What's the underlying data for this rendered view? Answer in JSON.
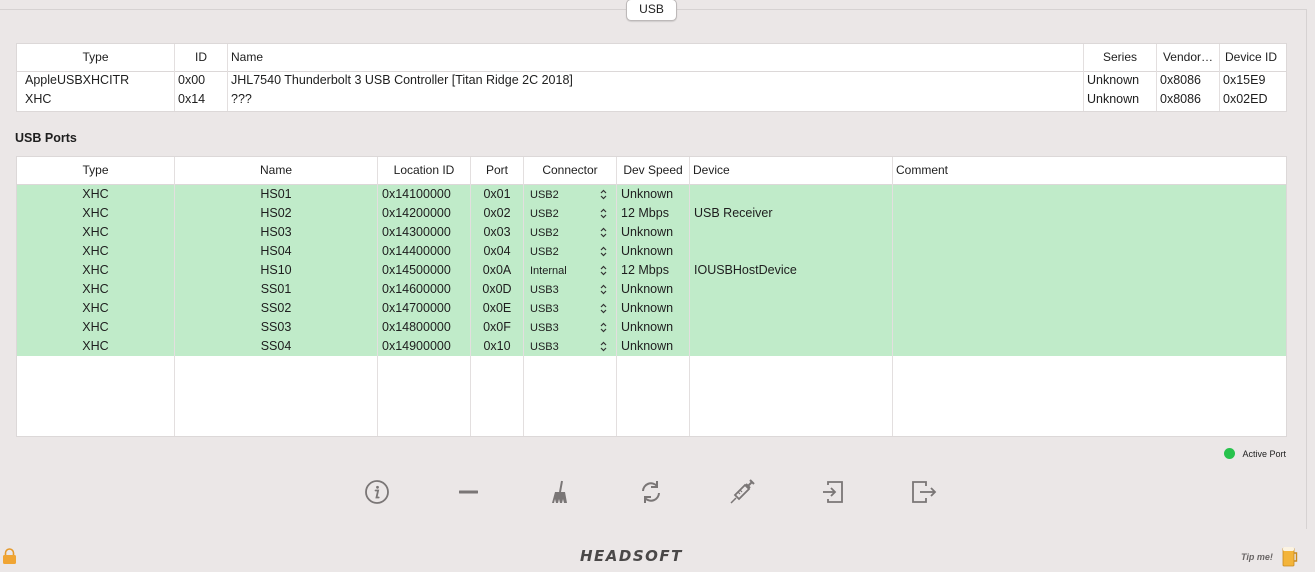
{
  "tabs": [
    {
      "label": "USB"
    }
  ],
  "controllers": {
    "columns": [
      "Type",
      "ID",
      "Name",
      "Series",
      "Vendor…",
      "Device ID"
    ],
    "rows": [
      {
        "type": "AppleUSBXHCITR",
        "id": "0x00",
        "name": "JHL7540 Thunderbolt 3 USB Controller [Titan Ridge 2C 2018]",
        "series": "Unknown",
        "vendor": "0x8086",
        "device": "0x15E9"
      },
      {
        "type": "XHC",
        "id": "0x14",
        "name": "???",
        "series": "Unknown",
        "vendor": "0x8086",
        "device": "0x02ED"
      }
    ]
  },
  "ports": {
    "title": "USB Ports",
    "columns": [
      "Type",
      "Name",
      "Location ID",
      "Port",
      "Connector",
      "Dev Speed",
      "Device",
      "Comment"
    ],
    "rows": [
      {
        "type": "XHC",
        "name": "HS01",
        "location": "0x14100000",
        "port": "0x01",
        "connector": "USB2",
        "speed": "Unknown",
        "device": "",
        "comment": ""
      },
      {
        "type": "XHC",
        "name": "HS02",
        "location": "0x14200000",
        "port": "0x02",
        "connector": "USB2",
        "speed": "12 Mbps",
        "device": "USB Receiver",
        "comment": ""
      },
      {
        "type": "XHC",
        "name": "HS03",
        "location": "0x14300000",
        "port": "0x03",
        "connector": "USB2",
        "speed": "Unknown",
        "device": "",
        "comment": ""
      },
      {
        "type": "XHC",
        "name": "HS04",
        "location": "0x14400000",
        "port": "0x04",
        "connector": "USB2",
        "speed": "Unknown",
        "device": "",
        "comment": ""
      },
      {
        "type": "XHC",
        "name": "HS10",
        "location": "0x14500000",
        "port": "0x0A",
        "connector": "Internal",
        "speed": "12 Mbps",
        "device": "IOUSBHostDevice",
        "comment": ""
      },
      {
        "type": "XHC",
        "name": "SS01",
        "location": "0x14600000",
        "port": "0x0D",
        "connector": "USB3",
        "speed": "Unknown",
        "device": "",
        "comment": ""
      },
      {
        "type": "XHC",
        "name": "SS02",
        "location": "0x14700000",
        "port": "0x0E",
        "connector": "USB3",
        "speed": "Unknown",
        "device": "",
        "comment": ""
      },
      {
        "type": "XHC",
        "name": "SS03",
        "location": "0x14800000",
        "port": "0x0F",
        "connector": "USB3",
        "speed": "Unknown",
        "device": "",
        "comment": ""
      },
      {
        "type": "XHC",
        "name": "SS04",
        "location": "0x14900000",
        "port": "0x10",
        "connector": "USB3",
        "speed": "Unknown",
        "device": "",
        "comment": ""
      }
    ],
    "active_color": "#c0ebc9"
  },
  "legend": {
    "label": "Active Port",
    "color": "#27c24c"
  },
  "toolbar": [
    {
      "icon": "info-icon"
    },
    {
      "icon": "minus-icon"
    },
    {
      "icon": "broom-icon"
    },
    {
      "icon": "refresh-icon"
    },
    {
      "icon": "syringe-icon"
    },
    {
      "icon": "import-icon"
    },
    {
      "icon": "export-icon"
    }
  ],
  "footer": {
    "brand": "HEADSOFT",
    "tip": "Tip me!"
  }
}
